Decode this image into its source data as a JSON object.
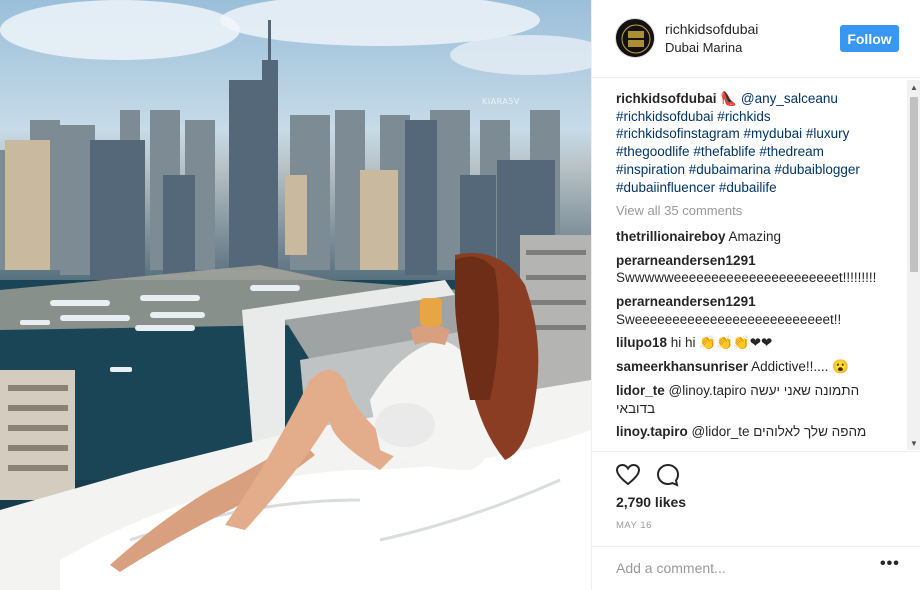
{
  "photo": {
    "watermark": "KIARA5V",
    "description_icon": "photo"
  },
  "post": {
    "username": "richkidsofdubai",
    "location": "Dubai Marina",
    "follow_label": "Follow",
    "avatar_text": "RICH KIDS"
  },
  "caption": {
    "username": "richkidsofdubai",
    "emoji": "👠",
    "mention": "@any_salceanu",
    "hashtags": "#richkidsofdubai #richkids #richkidsofinstagram #mydubai #luxury #thegoodlife #thefablife #thedream #inspiration #dubaimarina #dubaiblogger #dubaiinfluencer #dubailife"
  },
  "view_all": "View all 35 comments",
  "comments": [
    {
      "user": "thetrillionaireboy",
      "text": "Amazing"
    },
    {
      "user": "perarneandersen1291",
      "text": "Swwwwweeeeeeeeeeeeeeeeeeeeeet!!!!!!!!!"
    },
    {
      "user": "perarneandersen1291",
      "text": "Sweeeeeeeeeeeeeeeeeeeeeeeeeet!!"
    },
    {
      "user": "lilupo18",
      "text": "hi hi 👏👏👏❤❤"
    },
    {
      "user": "sameerkhansunriser",
      "text": "Addictive!!.... 😮"
    },
    {
      "user": "lidor_te",
      "text": "@linoy.tapiro התמונה שאני יעשה בדובאי"
    },
    {
      "user": "linoy.tapiro",
      "text": "@lidor_te מהפה שלך לאלוהים"
    }
  ],
  "actions": {
    "likes": "2,790 likes",
    "date": "MAY 16",
    "like_icon": "heart-icon",
    "comment_icon": "comment-icon"
  },
  "add_comment": {
    "placeholder": "Add a comment...",
    "more_label": "•••"
  },
  "colors": {
    "accent": "#3897f0",
    "link": "#003569",
    "muted": "#999999"
  }
}
